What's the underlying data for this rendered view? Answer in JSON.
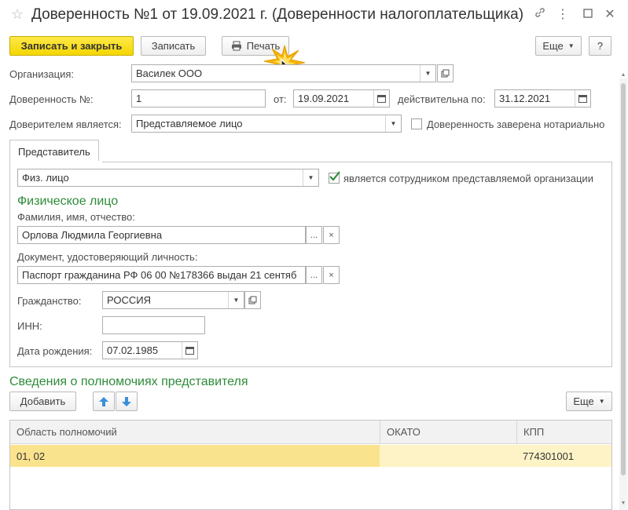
{
  "window": {
    "title": "Доверенность №1 от 19.09.2021 г. (Доверенности налогоплательщика)",
    "controls": [
      "link-icon",
      "more-vertical-icon",
      "maximize-icon",
      "close-icon"
    ]
  },
  "toolbar": {
    "save_close_label": "Записать и закрыть",
    "save_label": "Записать",
    "print_label": "Печать",
    "more_label": "Еще",
    "help_label": "?"
  },
  "form": {
    "organization_label": "Организация:",
    "organization_value": "Василек ООО",
    "poa_number_label": "Доверенность №:",
    "poa_number_value": "1",
    "from_label": "от:",
    "from_value": "19.09.2021",
    "valid_until_label": "действительна по:",
    "valid_until_value": "31.12.2021",
    "principal_label": "Доверителем является:",
    "principal_value": "Представляемое лицо",
    "notarized_label": "Доверенность заверена нотариально",
    "notarized_checked": false
  },
  "representative_tab": {
    "tab_label": "Представитель",
    "type_value": "Физ. лицо",
    "is_employee_label": "является сотрудником представляемой организации",
    "is_employee_checked": true,
    "section_title": "Физическое лицо",
    "fio_label": "Фамилия, имя, отчество:",
    "fio_value": "Орлова Людмила Георгиевна",
    "doc_label": "Документ, удостоверяющий личность:",
    "doc_value": "Паспорт гражданина РФ 06 00 №178366 выдан 21 сентяб",
    "citizenship_label": "Гражданство:",
    "citizenship_value": "РОССИЯ",
    "inn_label": "ИНН:",
    "inn_value": "",
    "birth_label": "Дата рождения:",
    "birth_value": "07.02.1985",
    "ellipsis": "...",
    "clear": "×"
  },
  "powers": {
    "title": "Сведения о полномочиях представителя",
    "add_label": "Добавить",
    "more_label": "Еще",
    "columns": [
      "Область полномочий",
      "ОКАТО",
      "КПП"
    ],
    "rows": [
      {
        "area": "01, 02",
        "okato": "",
        "kpp": "774301001"
      }
    ]
  },
  "colors": {
    "primary_button": "#f4d600",
    "section_heading": "#2e8b3a",
    "selected_row": "#fae38d",
    "selected_row_light": "#fdf3c6"
  }
}
